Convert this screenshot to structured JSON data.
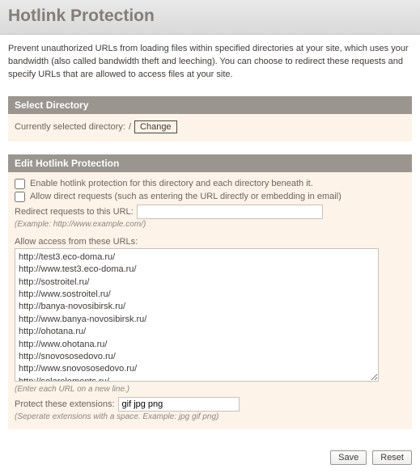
{
  "header": {
    "title": "Hotlink Protection"
  },
  "intro_text": "Prevent unauthorized URLs from loading files within specified directories at your site, which uses your bandwidth (also called bandwidth theft and leeching). You can choose to redirect these requests and specify URLs that are allowed to access files at your site.",
  "select_directory": {
    "heading": "Select Directory",
    "label": "Currently selected directory:",
    "path": "/",
    "change_btn": "Change"
  },
  "edit": {
    "heading": "Edit Hotlink Protection",
    "enable_cb_label": "Enable hotlink protection for this directory and each directory beneath it.",
    "allow_cb_label": "Allow direct requests (such as entering the URL directly or embedding in email)",
    "redirect_label": "Redirect requests to this URL:",
    "redirect_value": "",
    "redirect_hint": "(Example: http://www.example.com/)",
    "allow_label": "Allow access from these URLs:",
    "allow_urls": "http://test3.eco-doma.ru/\nhttp://www.test3.eco-doma.ru/\nhttp://sostroitel.ru/\nhttp://www.sostroitel.ru/\nhttp://banya-novosibirsk.ru/\nhttp://www.banya-novosibirsk.ru/\nhttp://ohotana.ru/\nhttp://www.ohotana.ru/\nhttp://snovososedovo.ru/\nhttp://www.snovososedovo.ru/\nhttp://solarelements.ru/",
    "allow_hint": "(Enter each URL on a new line.)",
    "protect_label": "Protect these extensions:",
    "protect_value": "gif jpg png",
    "protect_hint": "(Seperate extensions with a space. Example: jpg gif png)"
  },
  "buttons": {
    "save": "Save",
    "reset": "Reset"
  }
}
